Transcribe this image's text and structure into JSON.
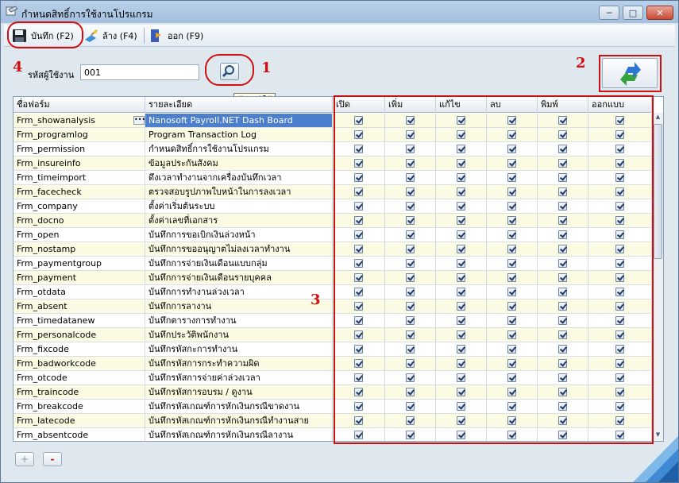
{
  "window": {
    "title": "กำหนดสิทธิ์การใช้งานโปรแกรม"
  },
  "toolbar": {
    "save_label": "บันทึก (F2)",
    "clear_label": "ล้าง (F4)",
    "exit_label": "ออก (F9)"
  },
  "user": {
    "label": "รหัสผู้ใช้งาน",
    "value": "001",
    "search_tooltip": "ค้นหาผู้ใช้"
  },
  "callouts": [
    "1",
    "2",
    "3",
    "4"
  ],
  "grid": {
    "columns": [
      "ชื่อฟอร์ม",
      "รายละเอียด",
      "เปิด",
      "เพิ่ม",
      "แก้ไข",
      "ลบ",
      "พิมพ์",
      "ออกแบบ"
    ],
    "rows": [
      {
        "form": "Frm_showanalysis",
        "desc": "Nanosoft Payroll.NET Dash Board",
        "perms": [
          true,
          true,
          true,
          true,
          true,
          true
        ]
      },
      {
        "form": "Frm_programlog",
        "desc": "Program Transaction Log",
        "perms": [
          true,
          true,
          true,
          true,
          true,
          true
        ]
      },
      {
        "form": "Frm_permission",
        "desc": "กำหนดสิทธิ์การใช้งานโปรแกรม",
        "perms": [
          true,
          true,
          true,
          true,
          true,
          true
        ]
      },
      {
        "form": "Frm_insureinfo",
        "desc": "ข้อมูลประกันสังคม",
        "perms": [
          true,
          true,
          true,
          true,
          true,
          true
        ]
      },
      {
        "form": "Frm_timeimport",
        "desc": "ดึงเวลาทำงานจากเครื่องบันทึกเวลา",
        "perms": [
          true,
          true,
          true,
          true,
          true,
          true
        ]
      },
      {
        "form": "Frm_facecheck",
        "desc": "ตรวจสอบรูปภาพใบหน้าในการลงเวลา",
        "perms": [
          true,
          true,
          true,
          true,
          true,
          true
        ]
      },
      {
        "form": "Frm_company",
        "desc": "ตั้งค่าเริ่มต้นระบบ",
        "perms": [
          true,
          true,
          true,
          true,
          true,
          true
        ]
      },
      {
        "form": "Frm_docno",
        "desc": "ตั้งค่าเลขที่เอกสาร",
        "perms": [
          true,
          true,
          true,
          true,
          true,
          true
        ]
      },
      {
        "form": "Frm_open",
        "desc": "บันทึกการขอเบิกเงินล่วงหน้า",
        "perms": [
          true,
          true,
          true,
          true,
          true,
          true
        ]
      },
      {
        "form": "Frm_nostamp",
        "desc": "บันทึกการขออนุญาตไม่ลงเวลาทำงาน",
        "perms": [
          true,
          true,
          true,
          true,
          true,
          true
        ]
      },
      {
        "form": "Frm_paymentgroup",
        "desc": "บันทึกการจ่ายเงินเดือนแบบกลุ่ม",
        "perms": [
          true,
          true,
          true,
          true,
          true,
          true
        ]
      },
      {
        "form": "Frm_payment",
        "desc": "บันทึกการจ่ายเงินเดือนรายบุคคล",
        "perms": [
          true,
          true,
          true,
          true,
          true,
          true
        ]
      },
      {
        "form": "Frm_otdata",
        "desc": "บันทึกการทำงานล่วงเวลา",
        "perms": [
          true,
          true,
          true,
          true,
          true,
          true
        ]
      },
      {
        "form": "Frm_absent",
        "desc": "บันทึกการลางาน",
        "perms": [
          true,
          true,
          true,
          true,
          true,
          true
        ]
      },
      {
        "form": "Frm_timedatanew",
        "desc": "บันทึกตารางการทำงาน",
        "perms": [
          true,
          true,
          true,
          true,
          true,
          true
        ]
      },
      {
        "form": "Frm_personalcode",
        "desc": "บันทึกประวัติพนักงาน",
        "perms": [
          true,
          true,
          true,
          true,
          true,
          true
        ]
      },
      {
        "form": "Frm_fixcode",
        "desc": "บันทึกรหัสกะการทำงาน",
        "perms": [
          true,
          true,
          true,
          true,
          true,
          true
        ]
      },
      {
        "form": "Frm_badworkcode",
        "desc": "บันทึกรหัสการกระทำความผิด",
        "perms": [
          true,
          true,
          true,
          true,
          true,
          true
        ]
      },
      {
        "form": "Frm_otcode",
        "desc": "บันทึกรหัสการจ่ายค่าล่วงเวลา",
        "perms": [
          true,
          true,
          true,
          true,
          true,
          true
        ]
      },
      {
        "form": "Frm_traincode",
        "desc": "บันทึกรหัสการอบรม / ดูงาน",
        "perms": [
          true,
          true,
          true,
          true,
          true,
          true
        ]
      },
      {
        "form": "Frm_breakcode",
        "desc": "บันทึกรหัสเกณฑ์การหักเงินกรณีขาดงาน",
        "perms": [
          true,
          true,
          true,
          true,
          true,
          true
        ]
      },
      {
        "form": "Frm_latecode",
        "desc": "บันทึกรหัสเกณฑ์การหักเงินกรณีทำงานสาย",
        "perms": [
          true,
          true,
          true,
          true,
          true,
          true
        ]
      },
      {
        "form": "Frm_absentcode",
        "desc": "บันทึกรหัสเกณฑ์การหักเงินกรณีลางาน",
        "perms": [
          true,
          true,
          true,
          true,
          true,
          true
        ]
      }
    ]
  },
  "footer": {
    "add_label": "+",
    "remove_label": "-"
  },
  "colors": {
    "selected_row": "#4d7fcf",
    "alt_row": "#fbfbe3",
    "annotation": "#d01010"
  }
}
